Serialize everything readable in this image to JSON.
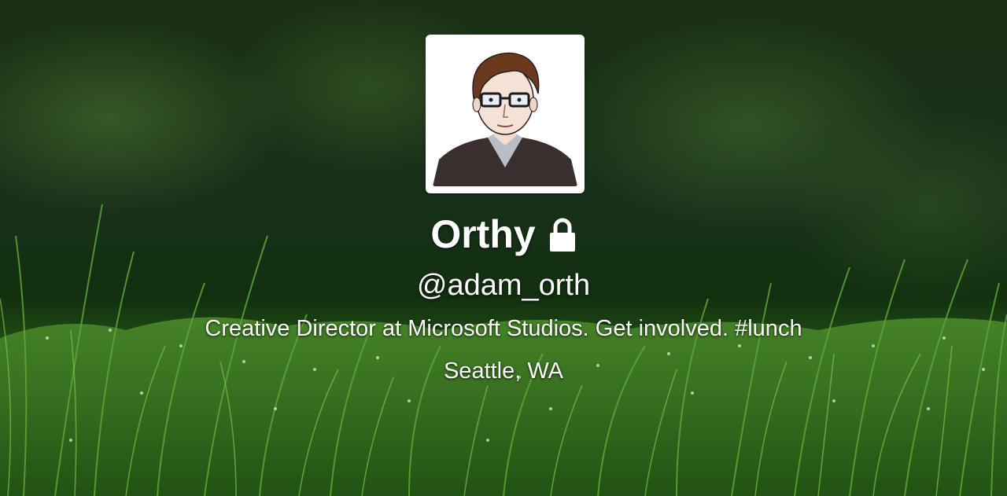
{
  "profile": {
    "display_name": "Orthy",
    "handle": "@adam_orth",
    "bio_text": "Creative Director at Microsoft Studios. Get involved. ",
    "bio_hashtag": "#lunch",
    "location": "Seattle, WA",
    "protected": true,
    "lock_icon": "lock-icon",
    "avatar_icon": "avatar-illustration"
  },
  "colors": {
    "text": "#ffffff",
    "background_dark": "#12300f",
    "grass": "#3a7a22"
  }
}
